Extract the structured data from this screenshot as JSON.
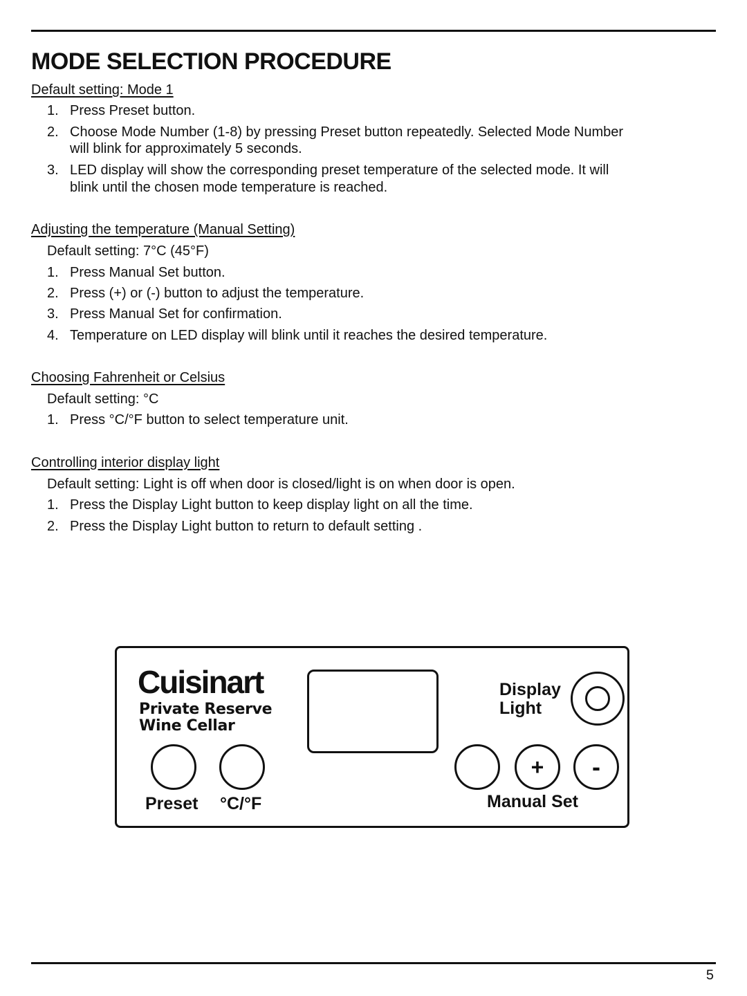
{
  "title": "MODE SELECTION PROCEDURE",
  "sections": [
    {
      "heading": "Default setting: Mode 1",
      "steps": [
        {
          "n": "1.",
          "text": "Press Preset button."
        },
        {
          "n": "2.",
          "line1": "Choose Mode Number (1-8) by pressing Preset button repeatedly. Selected Mode Number",
          "line2": "will blink for approximately 5 seconds."
        },
        {
          "n": "3.",
          "line1": "LED display will show the corresponding preset temperature of the selected mode. It will",
          "line2": "blink until the chosen mode temperature is reached."
        }
      ]
    },
    {
      "heading": "Adjusting the temperature (Manual Setting)",
      "default": "Default setting: 7°C (45°F)",
      "steps": [
        {
          "n": "1.",
          "text": "Press Manual Set button."
        },
        {
          "n": "2.",
          "text": "Press (+) or (-) button to adjust the temperature."
        },
        {
          "n": "3.",
          "text": "Press Manual Set for confirmation."
        },
        {
          "n": "4.",
          "text": "Temperature on LED display will blink until it reaches the desired temperature."
        }
      ]
    },
    {
      "heading": "Choosing Fahrenheit or Celsius",
      "default": "Default setting: °C",
      "steps": [
        {
          "n": "1.",
          "text": "Press °C/°F button to select temperature unit."
        }
      ]
    },
    {
      "heading": "Controlling interior display light",
      "default": "Default setting: Light is off when door is closed/light is on when door is open.",
      "steps": [
        {
          "n": "1.",
          "text": "Press the Display Light button to keep display light on all the time."
        },
        {
          "n": "2.",
          "text": "Press the Display Light button to return to default setting ."
        }
      ]
    }
  ],
  "panel": {
    "brand": "Cuisinart",
    "subtitle_line1": "Private Reserve",
    "subtitle_line2": "Wine Cellar",
    "preset_label": "Preset",
    "unit_label": "°C/°F",
    "display_light_line1": "Display",
    "display_light_line2": "Light",
    "plus_symbol": "+",
    "minus_symbol": "-",
    "manual_set_label": "Manual Set"
  },
  "page_number": "5"
}
